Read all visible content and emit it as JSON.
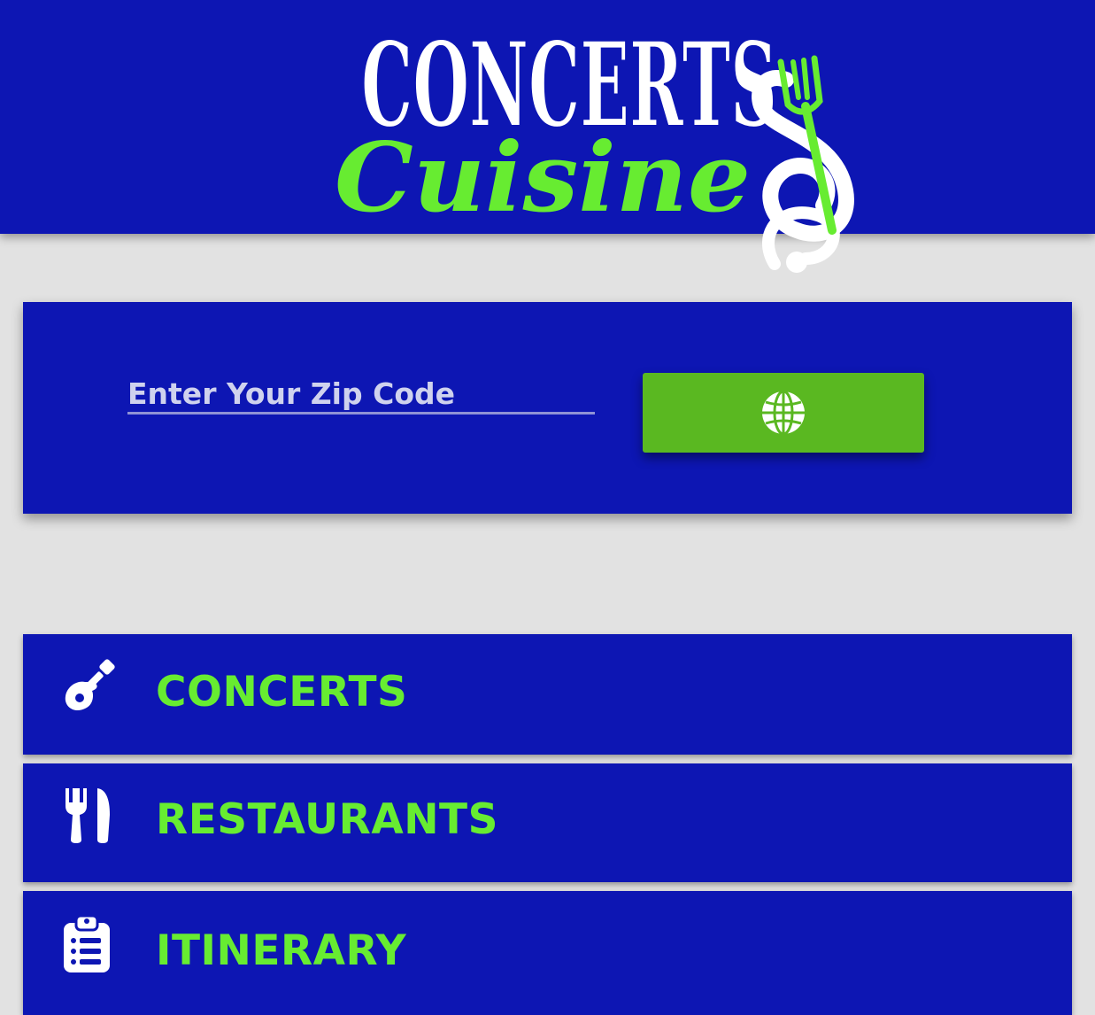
{
  "brand": {
    "logo_line1": "CONCERTS",
    "logo_line2": "Cuisine"
  },
  "search": {
    "zip_placeholder": "Enter Your Zip Code",
    "zip_value": "",
    "button_icon": "globe-icon"
  },
  "nav": {
    "items": [
      {
        "label": "CONCERTS",
        "icon": "guitar-icon"
      },
      {
        "label": "RESTAURANTS",
        "icon": "utensils-icon"
      },
      {
        "label": "ITINERARY",
        "icon": "clipboard-list-icon"
      }
    ]
  },
  "colors": {
    "primary_blue": "#0d16b3",
    "accent_green": "#67ec31",
    "button_green": "#5ab821",
    "background": "#e2e2e2"
  }
}
